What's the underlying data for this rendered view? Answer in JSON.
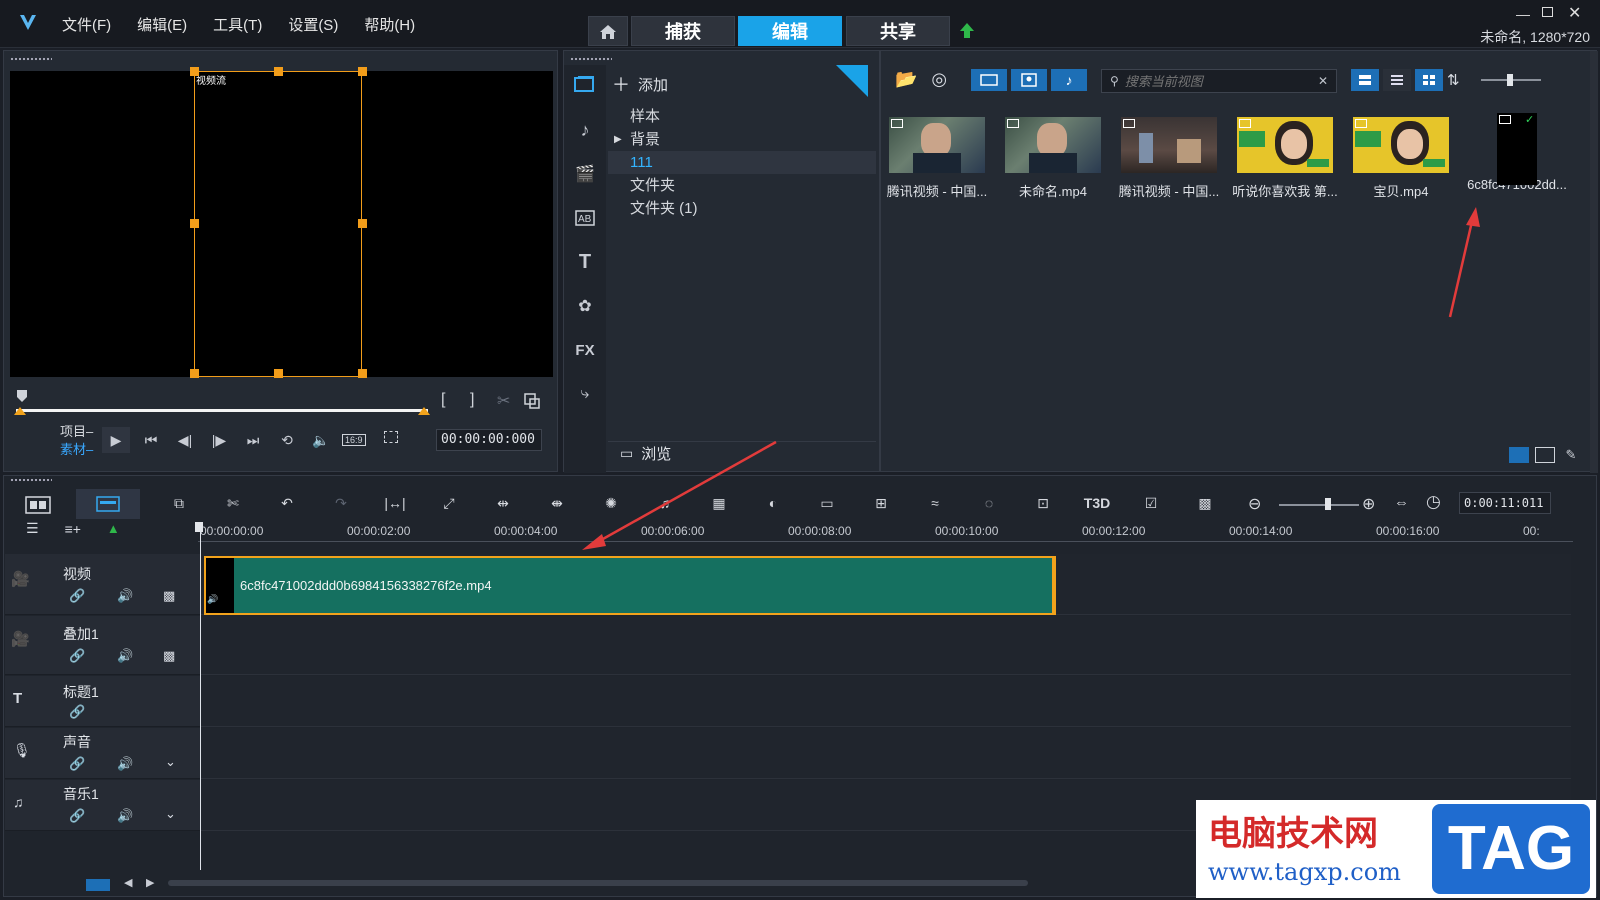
{
  "app": {
    "menu": [
      "文件(F)",
      "编辑(E)",
      "工具(T)",
      "设置(S)",
      "帮助(H)"
    ],
    "nav_tabs": [
      "捕获",
      "编辑",
      "共享"
    ],
    "active_tab": "编辑",
    "project_info": "未命名, 1280*720"
  },
  "player": {
    "overlay_text": "视频流",
    "mode_project": "项目–",
    "mode_clip": "素材–",
    "aspect": "16:9",
    "timecode": "00:00:00:000"
  },
  "library": {
    "add_label": "添加",
    "folders": [
      "样本",
      "背景",
      "111",
      "文件夹",
      "文件夹 (1)"
    ],
    "selected_folder": "111",
    "browse_label": "浏览",
    "search_placeholder": "搜索当前视图"
  },
  "media": [
    {
      "label": "腾讯视频 - 中国...",
      "kind": "video"
    },
    {
      "label": "未命名.mp4",
      "kind": "video"
    },
    {
      "label": "腾讯视频 - 中国...",
      "kind": "video"
    },
    {
      "label": "听说你喜欢我 第...",
      "kind": "video"
    },
    {
      "label": "宝贝.mp4",
      "kind": "video"
    },
    {
      "label": "6c8fc471002dd...",
      "kind": "video"
    }
  ],
  "timeline": {
    "timecode": "0:00:11:011",
    "ruler": [
      "00:00:00:00",
      "00:00:02:00",
      "00:00:04:00",
      "00:00:06:00",
      "00:00:08:00",
      "00:00:10:00",
      "00:00:12:00",
      "00:00:14:00",
      "00:00:16:00",
      "00:"
    ],
    "tracks": [
      "视频",
      "叠加1",
      "标题1",
      "声音",
      "音乐1"
    ],
    "clip_name": "6c8fc471002ddd0b6984156338276f2e.mp4"
  },
  "watermark": {
    "site_cn": "电脑技术网",
    "site_url": "www.tagxp.com",
    "badge": "TAG"
  },
  "colors": {
    "accent": "#1aa3e8",
    "clip": "#157060",
    "handle": "#f2a31c",
    "arrow": "#e23b3b"
  }
}
